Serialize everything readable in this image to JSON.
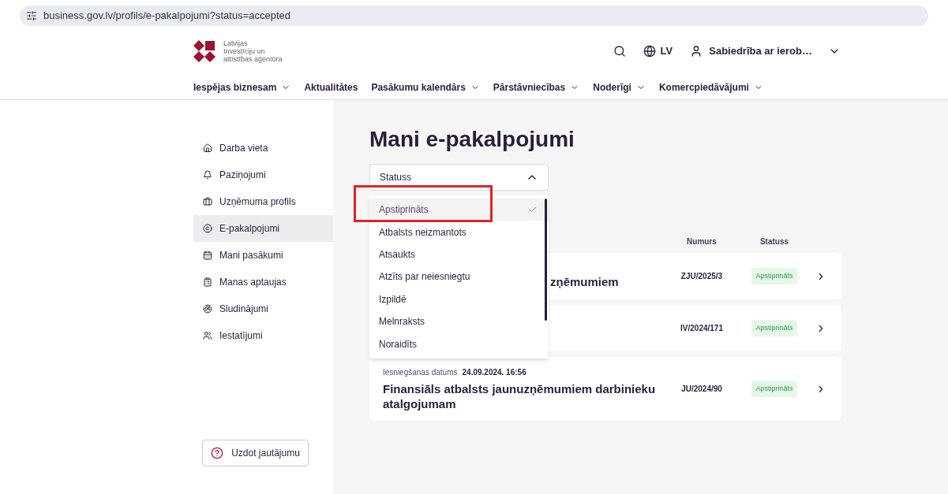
{
  "browser": {
    "url": "business.gov.lv/profils/e-pakalpojumi?status=accepted"
  },
  "header": {
    "logo_lines": [
      "Latvijas",
      "Investīciju un",
      "attīstības aģentūra"
    ],
    "language": "LV",
    "account": "Sabiedrība ar ierob…"
  },
  "nav": [
    {
      "label": "Iespējas biznesam",
      "dropdown": true
    },
    {
      "label": "Aktualitātes",
      "dropdown": false
    },
    {
      "label": "Pasākumu kalendārs",
      "dropdown": true
    },
    {
      "label": "Pārstāvniecības",
      "dropdown": true
    },
    {
      "label": "Noderīgi",
      "dropdown": true
    },
    {
      "label": "Komercpiedāvājumi",
      "dropdown": true
    }
  ],
  "sidebar": {
    "items": [
      {
        "kind": "home",
        "label": "Darba vieta",
        "selected": false
      },
      {
        "kind": "bell",
        "label": "Paziņojumi",
        "selected": false
      },
      {
        "kind": "briefcase",
        "label": "Uzņēmuma profils",
        "selected": false
      },
      {
        "kind": "services",
        "label": "E-pakalpojumi",
        "selected": true
      },
      {
        "kind": "calendar",
        "label": "Mani pasākumi",
        "selected": false
      },
      {
        "kind": "survey",
        "label": "Manas aptaujas",
        "selected": false
      },
      {
        "kind": "radar",
        "label": "Sludinājumi",
        "selected": false
      },
      {
        "kind": "users",
        "label": "Iestatījumi",
        "selected": false
      }
    ],
    "ask_button": "Uzdot jautājumu"
  },
  "page_title": "Mani e-pakalpojumi",
  "filter": {
    "label": "Statuss",
    "expanded": true,
    "options": [
      {
        "label": "Apstiprināts",
        "selected": true
      },
      {
        "label": "Atbalsts neizmantots",
        "selected": false
      },
      {
        "label": "Atsaukts",
        "selected": false
      },
      {
        "label": "Atzīts par neiesniegtu",
        "selected": false
      },
      {
        "label": "Izpildē",
        "selected": false
      },
      {
        "label": "Melnraksts",
        "selected": false
      },
      {
        "label": "Noraidīts",
        "selected": false
      }
    ]
  },
  "columns": [
    "Numurs",
    "Statuss"
  ],
  "cards": [
    {
      "title": "zņēmumiem",
      "number": "ZJU/2025/3",
      "status": "Apstiprināts",
      "color": "#e6f7ea"
    },
    {
      "number": "IV/2024/171",
      "status": "Apstiprināts",
      "color": "#e6f7ea"
    },
    {
      "date_label": "Iesniegšanas datums",
      "date": "24.09.2024. 16:56",
      "title": "Finansiāls atbalsts jaunuzņēmumiem darbinieku atalgojumam",
      "number": "JU/2024/90",
      "status": "Apstiprināts",
      "color": "#e6f7ea"
    }
  ]
}
